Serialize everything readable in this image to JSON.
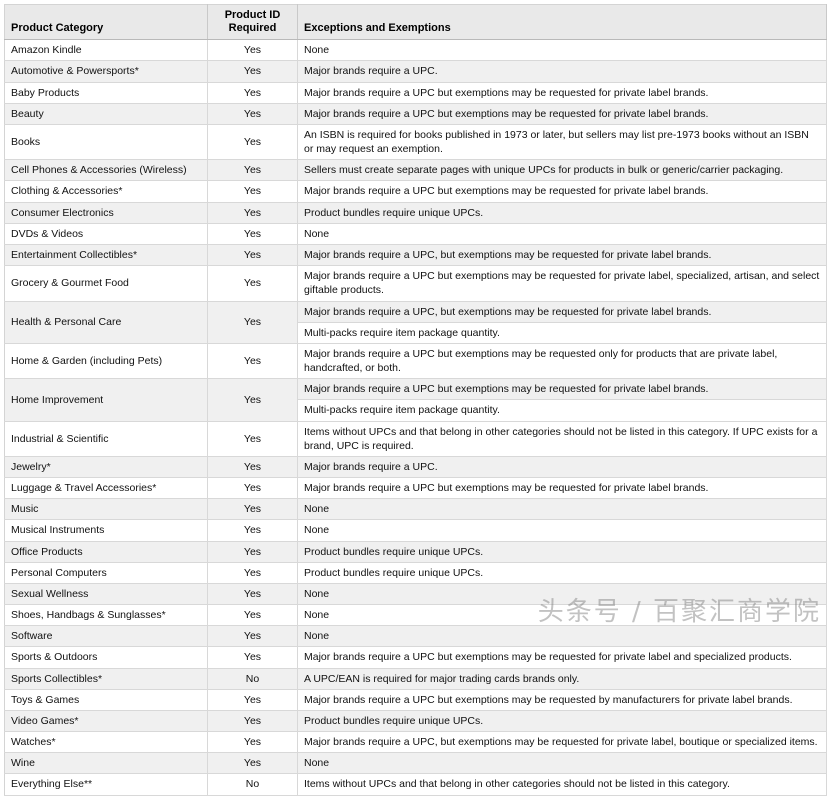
{
  "table": {
    "columns": [
      {
        "key": "category",
        "label": "Product Category"
      },
      {
        "key": "required",
        "label": "Product ID\nRequired"
      },
      {
        "key": "exceptions",
        "label": "Exceptions and Exemptions"
      }
    ],
    "headers": {
      "category": "Product Category",
      "required_line1": "Product ID",
      "required_line2": "Required",
      "exceptions": "Exceptions and Exemptions"
    },
    "rows": [
      {
        "category": "Amazon Kindle",
        "required": "Yes",
        "exceptions": [
          "None"
        ]
      },
      {
        "category": "Automotive & Powersports*",
        "required": "Yes",
        "exceptions": [
          "Major brands require a UPC."
        ]
      },
      {
        "category": "Baby Products",
        "required": "Yes",
        "exceptions": [
          "Major brands require a UPC but exemptions may be requested for private label brands."
        ]
      },
      {
        "category": "Beauty",
        "required": "Yes",
        "exceptions": [
          "Major brands require a UPC but exemptions may be requested for private label brands."
        ]
      },
      {
        "category": "Books",
        "required": "Yes",
        "exceptions": [
          "An ISBN is required for books published in 1973 or later, but sellers may list pre-1973 books without an ISBN or may request an exemption."
        ]
      },
      {
        "category": "Cell Phones & Accessories (Wireless)",
        "required": "Yes",
        "exceptions": [
          "Sellers must create separate pages with unique UPCs for products in bulk or generic/carrier packaging."
        ]
      },
      {
        "category": "Clothing & Accessories*",
        "required": "Yes",
        "exceptions": [
          "Major brands require a UPC but exemptions may be requested for private label brands."
        ]
      },
      {
        "category": "Consumer Electronics",
        "required": "Yes",
        "exceptions": [
          "Product bundles require unique UPCs."
        ]
      },
      {
        "category": "DVDs & Videos",
        "required": "Yes",
        "exceptions": [
          "None"
        ]
      },
      {
        "category": "Entertainment Collectibles*",
        "required": "Yes",
        "exceptions": [
          "Major brands require a UPC, but exemptions may be requested for private label brands."
        ]
      },
      {
        "category": "Grocery & Gourmet Food",
        "required": "Yes",
        "exceptions": [
          "Major brands require a UPC but exemptions may be requested for private label, specialized, artisan, and select giftable products."
        ]
      },
      {
        "category": "Health & Personal Care",
        "required": "Yes",
        "exceptions": [
          "Major brands require a UPC, but exemptions may be requested for private label brands.",
          "Multi-packs require item package quantity."
        ]
      },
      {
        "category": "Home & Garden (including Pets)",
        "required": "Yes",
        "exceptions": [
          "Major brands require a UPC but exemptions may be requested only for products that are private label, handcrafted, or both."
        ]
      },
      {
        "category": "Home Improvement",
        "required": "Yes",
        "exceptions": [
          "Major brands require a UPC but exemptions may be requested for private label brands.",
          "Multi-packs require item package quantity."
        ]
      },
      {
        "category": "Industrial & Scientific",
        "required": "Yes",
        "exceptions": [
          "Items without UPCs and that belong in other categories should not be listed in this category. If UPC exists for a brand, UPC is required."
        ]
      },
      {
        "category": "Jewelry*",
        "required": "Yes",
        "exceptions": [
          "Major brands require a UPC."
        ]
      },
      {
        "category": "Luggage & Travel Accessories*",
        "required": "Yes",
        "exceptions": [
          "Major brands require a UPC but exemptions may be requested for private label brands."
        ]
      },
      {
        "category": "Music",
        "required": "Yes",
        "exceptions": [
          "None"
        ]
      },
      {
        "category": "Musical Instruments",
        "required": "Yes",
        "exceptions": [
          "None"
        ]
      },
      {
        "category": "Office Products",
        "required": "Yes",
        "exceptions": [
          "Product bundles require unique UPCs."
        ]
      },
      {
        "category": "Personal Computers",
        "required": "Yes",
        "exceptions": [
          "Product bundles require unique UPCs."
        ]
      },
      {
        "category": "Sexual Wellness",
        "required": "Yes",
        "exceptions": [
          "None"
        ]
      },
      {
        "category": "Shoes, Handbags & Sunglasses*",
        "required": "Yes",
        "exceptions": [
          "None"
        ]
      },
      {
        "category": "Software",
        "required": "Yes",
        "exceptions": [
          "None"
        ]
      },
      {
        "category": "Sports & Outdoors",
        "required": "Yes",
        "exceptions": [
          "Major brands require a UPC but exemptions may be requested for private label and specialized products."
        ]
      },
      {
        "category": "Sports Collectibles*",
        "required": "No",
        "exceptions": [
          "A UPC/EAN is required for major trading cards brands only."
        ]
      },
      {
        "category": "Toys & Games",
        "required": "Yes",
        "exceptions": [
          "Major brands require a UPC but exemptions may be requested by manufacturers for private label brands."
        ]
      },
      {
        "category": "Video Games*",
        "required": "Yes",
        "exceptions": [
          "Product bundles require unique UPCs."
        ]
      },
      {
        "category": "Watches*",
        "required": "Yes",
        "exceptions": [
          "Major brands require a UPC, but exemptions may be requested for private label, boutique or specialized items."
        ]
      },
      {
        "category": "Wine",
        "required": "Yes",
        "exceptions": [
          "None"
        ]
      },
      {
        "category": "Everything Else**",
        "required": "No",
        "exceptions": [
          "Items without UPCs and that belong in other categories should not be listed in this category."
        ]
      }
    ]
  },
  "watermark": {
    "text": "头条号 / 百聚汇商学院"
  },
  "colors": {
    "header_bg": "#e9e9e9",
    "row_alt_bg": "#f0f0f0",
    "row_bg": "#ffffff",
    "border": "#d8d8d8",
    "text": "#111111"
  }
}
